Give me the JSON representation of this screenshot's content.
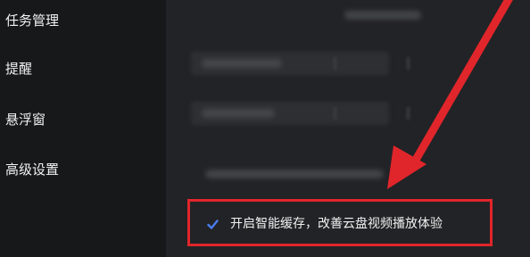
{
  "sidebar": {
    "items": [
      {
        "label": "任务管理"
      },
      {
        "label": "提醒"
      },
      {
        "label": "悬浮窗"
      },
      {
        "label": "高级设置"
      }
    ]
  },
  "main": {
    "smart_cache": {
      "checked": true,
      "label": "开启智能缓存，改善云盘视频播放体验"
    }
  },
  "colors": {
    "highlight": "#e0262b",
    "checkbox_accent": "#4a7cf0"
  }
}
